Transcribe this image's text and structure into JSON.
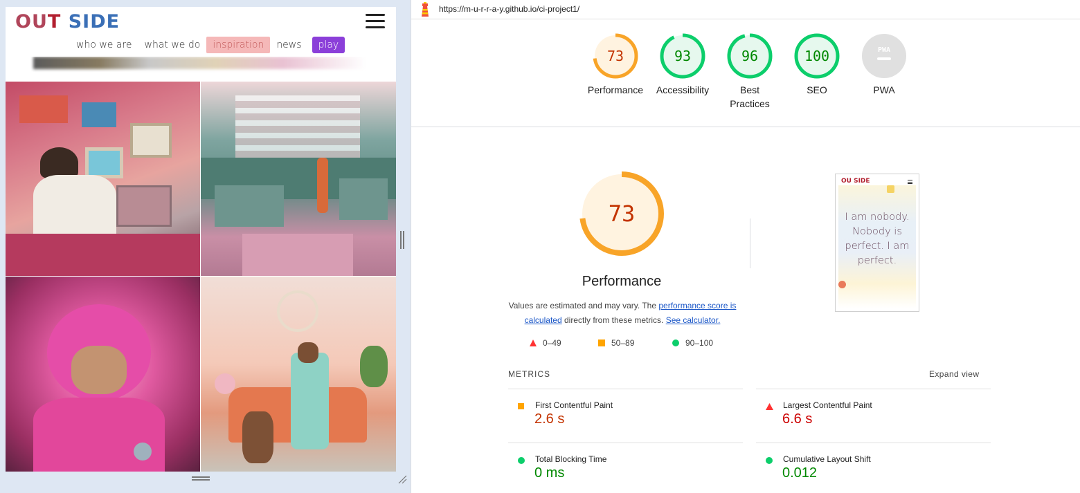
{
  "site": {
    "logo_text": "OUT SIDE",
    "nav": [
      "who we are",
      "what we do",
      "inspiration",
      "news",
      "play"
    ]
  },
  "lighthouse": {
    "url": "https://m-u-r-r-a-y.github.io/ci-project1/",
    "categories": [
      {
        "label": "Performance",
        "score": "73",
        "value": 73,
        "color": "#f8a428",
        "bg": "#fff3e0",
        "text_color": "#c33300"
      },
      {
        "label": "Accessibility",
        "score": "93",
        "value": 93,
        "color": "#0cce6b",
        "bg": "#e6f8ee",
        "text_color": "#008800"
      },
      {
        "label": "Best\nPractices",
        "score": "96",
        "value": 96,
        "color": "#0cce6b",
        "bg": "#e6f8ee",
        "text_color": "#008800"
      },
      {
        "label": "SEO",
        "score": "100",
        "value": 100,
        "color": "#0cce6b",
        "bg": "#e6f8ee",
        "text_color": "#008800"
      },
      {
        "label": "PWA",
        "score": "PWA",
        "value": 0,
        "color": "#cccccc",
        "bg": "#e0e0e0",
        "text_color": "#ffffff"
      }
    ],
    "performance": {
      "score": "73",
      "title": "Performance",
      "desc_prefix": "Values are estimated and may vary. The ",
      "desc_link1": "performance score is calculated",
      "desc_middle": " directly from these metrics. ",
      "desc_link2": "See calculator."
    },
    "legend": [
      {
        "range": "0–49",
        "shape": "triangle",
        "color": "#ff3333"
      },
      {
        "range": "50–89",
        "shape": "square",
        "color": "#ffa400"
      },
      {
        "range": "90–100",
        "shape": "circle",
        "color": "#0cce6b"
      }
    ],
    "thumbnail": {
      "logo": "OU SIDE",
      "quote": "I am nobody. Nobody is perfect. I am perfect."
    },
    "metrics_title": "METRICS",
    "expand_view": "Expand view",
    "metrics": [
      {
        "name": "First Contentful Paint",
        "value": "2.6 s",
        "status": "square",
        "color": "#ffa400",
        "value_color": "#c33300"
      },
      {
        "name": "Largest Contentful Paint",
        "value": "6.6 s",
        "status": "triangle",
        "color": "#ff3333",
        "value_color": "#cc0000"
      },
      {
        "name": "Total Blocking Time",
        "value": "0 ms",
        "status": "circle",
        "color": "#0cce6b",
        "value_color": "#008800"
      },
      {
        "name": "Cumulative Layout Shift",
        "value": "0.012",
        "status": "circle",
        "color": "#0cce6b",
        "value_color": "#008800"
      }
    ]
  }
}
